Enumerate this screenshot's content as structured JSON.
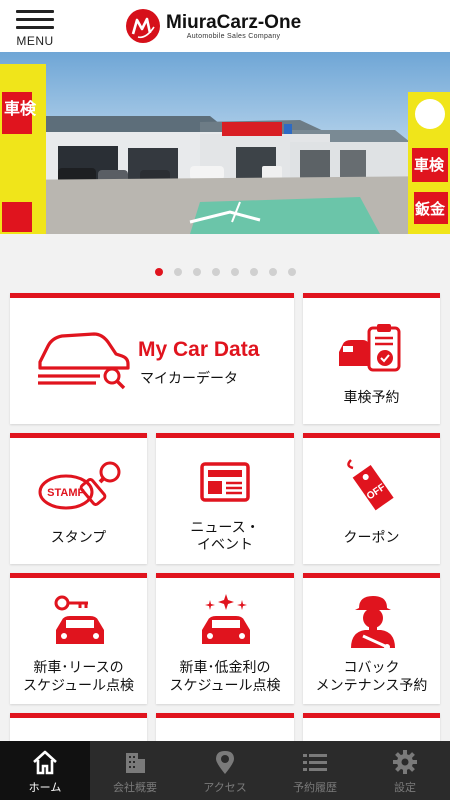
{
  "header": {
    "menu_label": "MENU",
    "logo_title": "MiuraCarz-One",
    "logo_subtitle": "Automobile Sales Company"
  },
  "hero": {
    "sign_left": "車検",
    "sign_right": "車検",
    "sign_right2": "鈑金"
  },
  "carousel": {
    "count": 8,
    "active_index": 0
  },
  "tiles": {
    "mycar": {
      "title": "My Car Data",
      "subtitle": "マイカーデータ"
    },
    "shaken": {
      "label": "車検予約"
    },
    "stamp": {
      "label": "スタンプ",
      "icon_text": "STAMP"
    },
    "news": {
      "line1": "ニュース・",
      "line2": "イベント"
    },
    "coupon": {
      "label": "クーポン",
      "icon_text": "OFF"
    },
    "lease": {
      "line1": "新車･リースの",
      "line2": "スケジュール点検"
    },
    "lowrate": {
      "line1": "新車･低金利の",
      "line2": "スケジュール点検"
    },
    "maint": {
      "line1": "コバック",
      "line2": "メンテナンス予約"
    }
  },
  "tabbar": {
    "items": [
      {
        "label": "ホーム",
        "icon": "home-icon",
        "active": true
      },
      {
        "label": "会社概要",
        "icon": "building-icon",
        "active": false
      },
      {
        "label": "アクセス",
        "icon": "map-pin-icon",
        "active": false
      },
      {
        "label": "予約履歴",
        "icon": "list-icon",
        "active": false
      },
      {
        "label": "設定",
        "icon": "gear-icon",
        "active": false
      }
    ]
  },
  "colors": {
    "accent": "#e0141e",
    "tabbar": "#2b2b2b",
    "text": "#111111"
  }
}
